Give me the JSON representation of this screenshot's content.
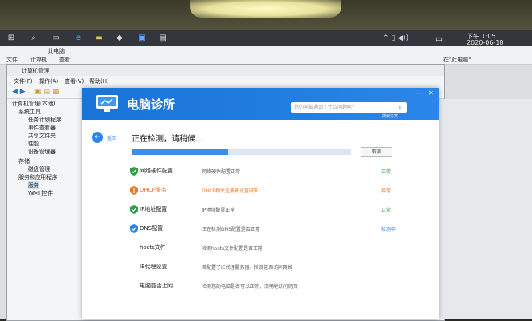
{
  "taskbar": {
    "icons": [
      "windows-icon",
      "search-icon",
      "task-view-icon",
      "edge-icon",
      "explorer-icon",
      "app-icon-1",
      "app-icon-2",
      "app-icon-3"
    ],
    "ime": "中",
    "time": "下午 1:05",
    "date": "2020-06-18"
  },
  "explorer": {
    "title": "此电脑",
    "tabs": [
      "文件",
      "计算机",
      "查看"
    ],
    "right_label": "在\"此电脑\""
  },
  "mgmt": {
    "title": "计算机管理",
    "menu": [
      "文件(F)",
      "操作(A)",
      "查看(V)",
      "帮助(H)"
    ],
    "tree": [
      "计算机管理(本地)",
      "系统工具",
      "任务计划程序",
      "事件查看器",
      "共享文件夹",
      "性能",
      "设备管理器",
      "存储",
      "磁盘管理",
      "服务和应用程序",
      "服务",
      "WMI 控件"
    ]
  },
  "app": {
    "title": "电脑诊所",
    "search_placeholder": "您的电脑遇到了什么问题呢?",
    "search_sub": "搜索方案",
    "back_label": "返回",
    "status": "正在检测，请稍候...",
    "progress_fraction": 0.44,
    "cancel_label": "取消",
    "rows": [
      {
        "name": "网络硬件配置",
        "desc": "网络硬件配置正常",
        "state": "正常",
        "kind": "ok"
      },
      {
        "name": "DHCP服务",
        "desc": "DHCP相关注册表设置缺失",
        "state": "异常",
        "kind": "warn"
      },
      {
        "name": "IP地址配置",
        "desc": "IP地址配置正常",
        "state": "正常",
        "kind": "ok"
      },
      {
        "name": "DNS配置",
        "desc": "正在检测DNS配置是否正常",
        "state": "检测中",
        "kind": "checking"
      },
      {
        "name": "hosts文件",
        "desc": "检测hosts文件配置是否正常",
        "state": "",
        "kind": "pending"
      },
      {
        "name": "IE代理设置",
        "desc": "若配置了IE代理服务器，检测能否访问网络",
        "state": "",
        "kind": "pending"
      },
      {
        "name": "电脑能否上网",
        "desc": "检测您的电脑是否可以正常，流畅地访问网页",
        "state": "",
        "kind": "pending"
      }
    ],
    "colors": {
      "accent": "#2a86ea",
      "ok": "#2f9e44",
      "warn": "#e8772a"
    }
  }
}
